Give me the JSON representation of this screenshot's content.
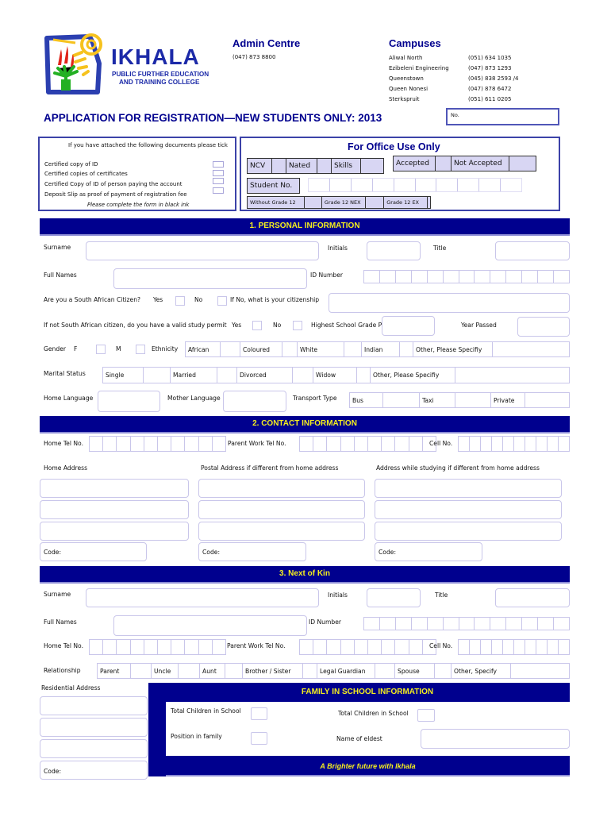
{
  "logo": {
    "name": "IKHALA",
    "subtitle_line1": "PUBLIC FURTHER EDUCATION",
    "subtitle_line2": "AND TRAINING COLLEGE"
  },
  "admin": {
    "title": "Admin Centre",
    "phone": "(047) 873 8800"
  },
  "campuses": {
    "title": "Campuses",
    "items": [
      {
        "name": "Aliwal North",
        "phone": "(051) 634 1035"
      },
      {
        "name": "Ezibeleni Engineering",
        "phone": "(047) 873 1293"
      },
      {
        "name": "Queenstown",
        "phone": "(045) 838 2593 /4"
      },
      {
        "name": "Queen Nonesi",
        "phone": "(047) 878 6472"
      },
      {
        "name": "Sterkspruit",
        "phone": "(051) 611 0205"
      }
    ]
  },
  "form_title": "APPLICATION FOR REGISTRATION—NEW STUDENTS ONLY:  2013",
  "no_label": "No.",
  "documents": {
    "heading": "If you have attached the following documents please tick",
    "items": [
      "Certified copy of ID",
      "Certified copies of certificates",
      "Certified Copy of ID of person paying the account",
      "Deposit Slip as proof of payment of registration fee"
    ],
    "note": "Please complete the form in black ink"
  },
  "office": {
    "title": "For Office Use Only",
    "programs": [
      "NCV",
      "Nated",
      "Skills"
    ],
    "status": [
      "Accepted",
      "Not Accepted"
    ],
    "student_no_label": "Student No.",
    "grades": [
      "Without Grade 12",
      "Grade 12 NEX",
      "Grade 12 EX"
    ]
  },
  "personal": {
    "heading": "1. PERSONAL INFORMATION",
    "surname": "Surname",
    "initials": "Initials",
    "title": "Title",
    "full_names": "Full  Names",
    "id_number": "ID Number",
    "citizen_q": "Are you a South African Citizen?",
    "yes": "Yes",
    "no": "No",
    "citizenship_q": "If No, what is your citizenship",
    "permit_q": "If not South African citizen, do you have a valid study permit",
    "highest_grade": "Highest School Grade Passed",
    "year_passed": "Year Passed",
    "gender": "Gender",
    "female": "F",
    "male": "M",
    "ethnicity": "Ethnicity",
    "ethnicity_options": [
      "African",
      "Coloured",
      "White",
      "Indian",
      "Other, Please Specifiy"
    ],
    "marital_status": "Marital Status",
    "marital_options": [
      "Single",
      "Married",
      "Divorced",
      "Widow",
      "Other, Please Specifiy"
    ],
    "home_language": "Home Language",
    "mother_language": "Mother Language",
    "transport_type": "Transport Type",
    "transport_options": [
      "Bus",
      "Taxi",
      "Private"
    ]
  },
  "contact": {
    "heading": "2. CONTACT INFORMATION",
    "home_tel": "Home Tel No.",
    "parent_work_tel": "Parent Work Tel No.",
    "cell": "Cell No.",
    "home_address": "Home Address",
    "postal_address": "Postal Address if different from home address",
    "study_address": "Address while studying if different from home address",
    "code": "Code:"
  },
  "kin": {
    "heading": "3. Next of Kin",
    "surname": "Surname",
    "initials": "Initials",
    "title": "Title",
    "full_names": "Full  Names",
    "id_number": "ID Number",
    "home_tel": "Home Tel No.",
    "parent_work_tel": "Parent Work Tel No.",
    "cell": "Cell No.",
    "relationship": "Relationship",
    "relationship_options": [
      "Parent",
      "Uncle",
      "Aunt",
      "Brother / Sister",
      "Legal Guardian",
      "Spouse",
      "Other, Specify"
    ],
    "residential_address": "Residential Address",
    "code": "Code:"
  },
  "family": {
    "heading": "FAMILY IN SCHOOL INFORMATION",
    "total_children_1": "Total Children in School",
    "total_children_2": "Total Children in School",
    "position": "Position in family",
    "eldest": "Name of eldest"
  },
  "footer": "A Brighter future with Ikhala",
  "colors": {
    "brand_blue": "#00008e",
    "band_text": "#f5ee1e",
    "field_border": "#c9c6ea",
    "office_fill": "#d8d6f3"
  }
}
